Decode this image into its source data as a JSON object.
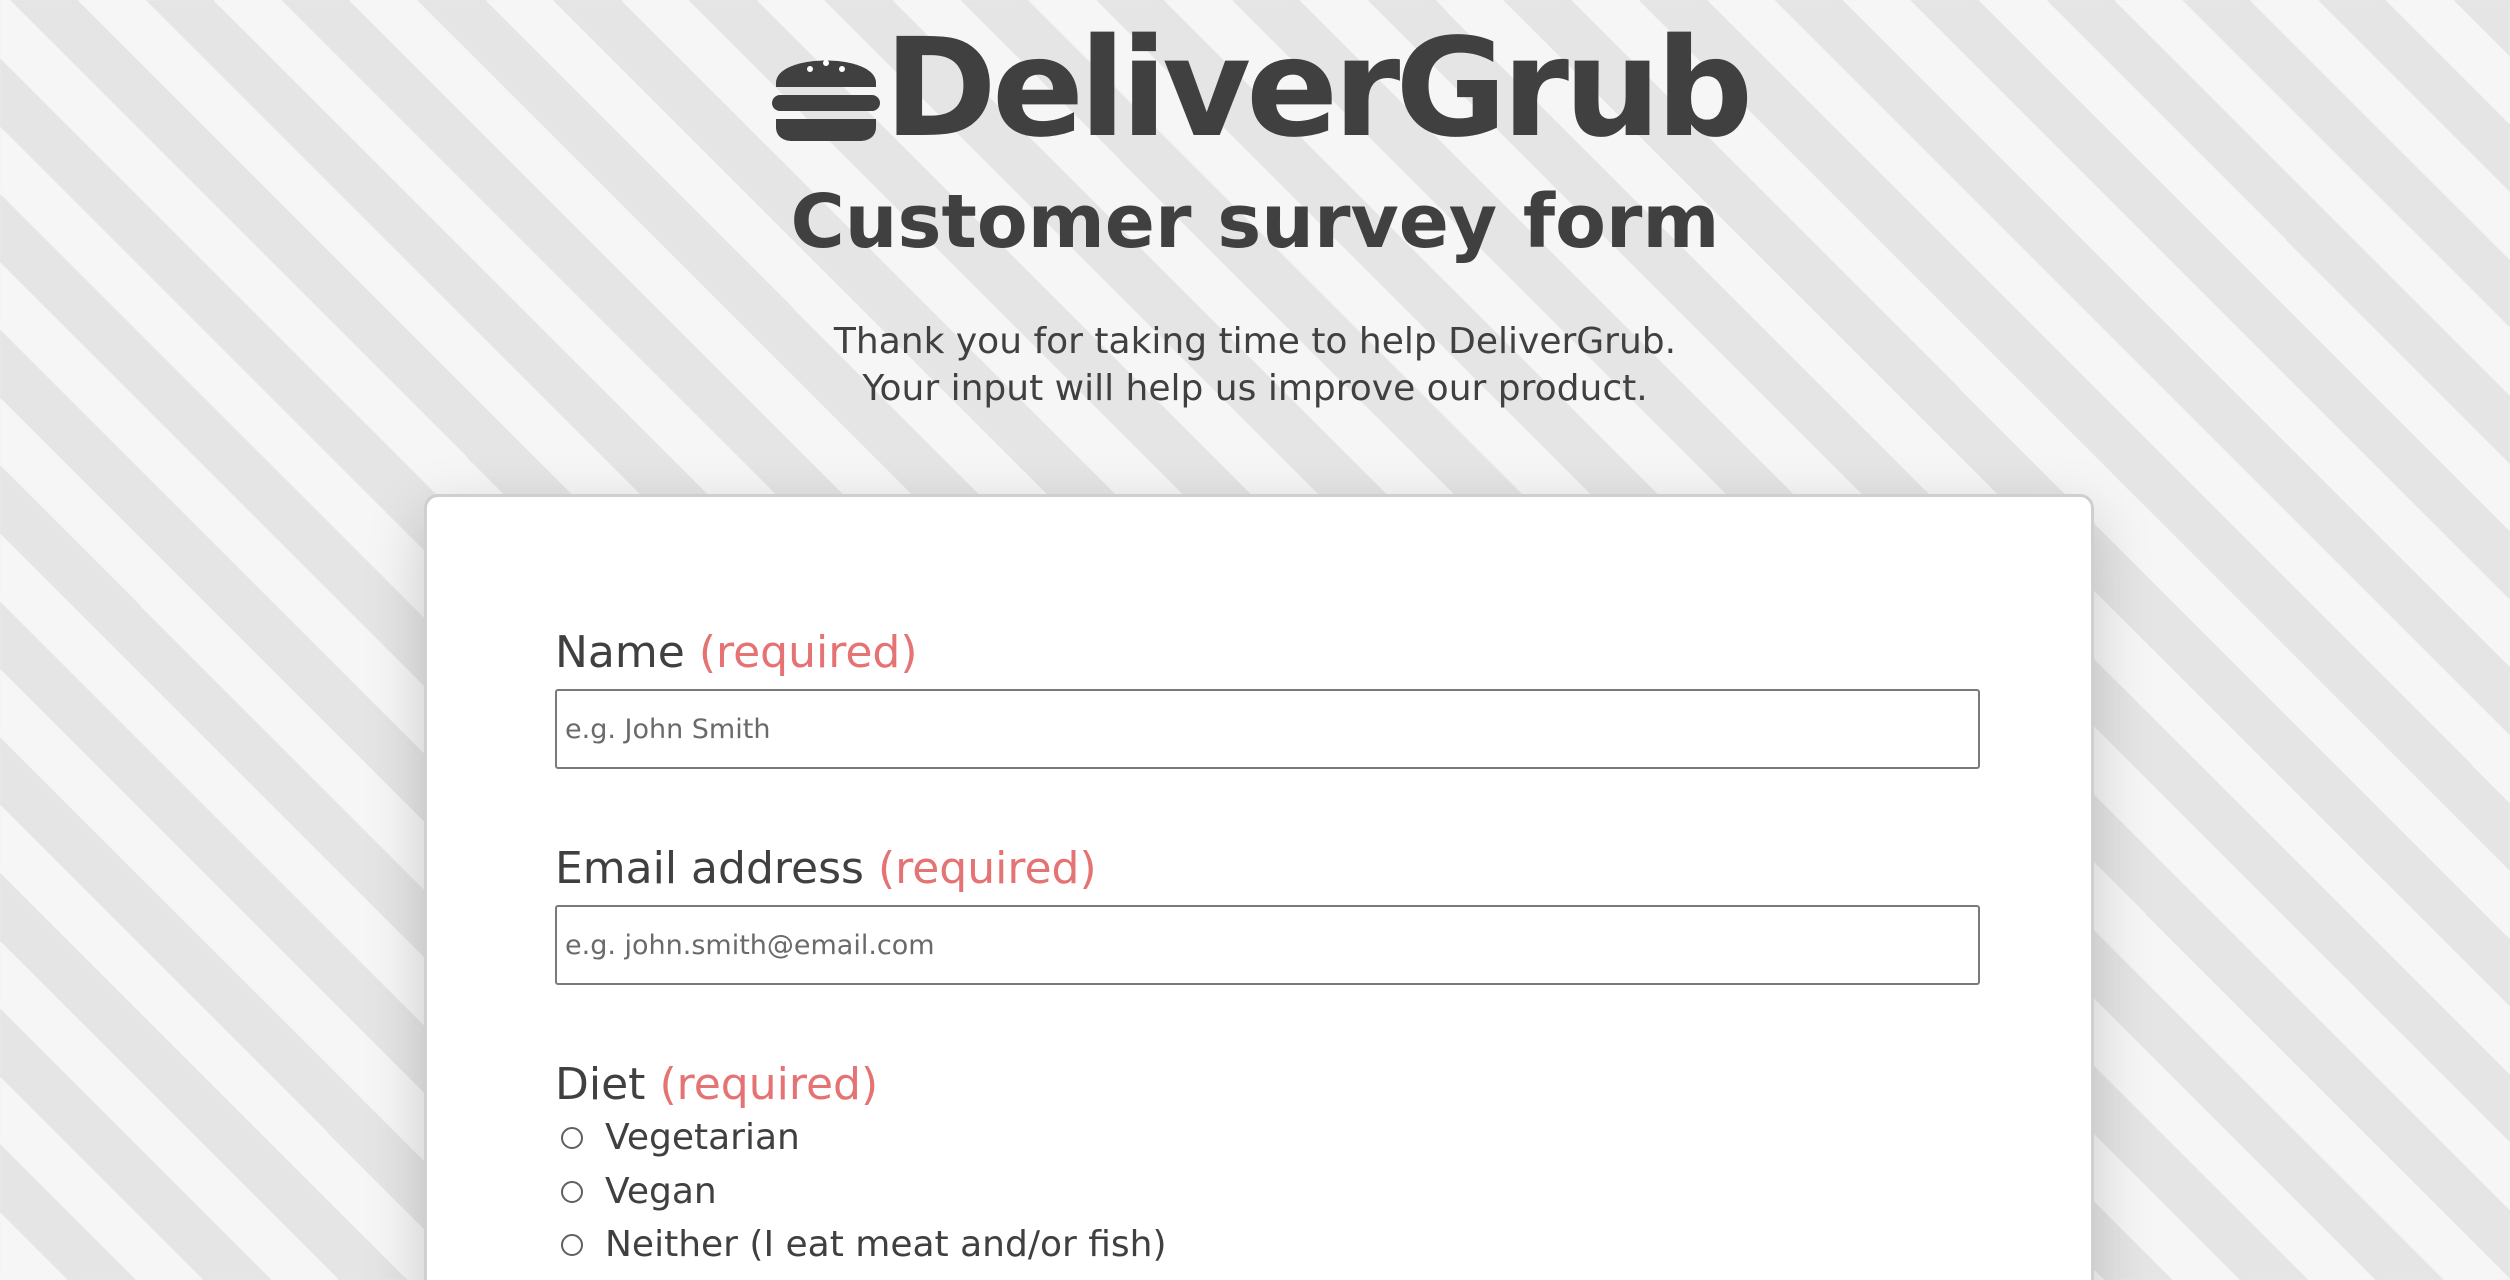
{
  "brand": {
    "icon": "burger-icon",
    "name": "DeliverGrub"
  },
  "page": {
    "title": "Customer survey form",
    "intro_line1": "Thank you for taking time to help DeliverGrub.",
    "intro_line2": "Your input will help us improve our product."
  },
  "form": {
    "name": {
      "label": "Name",
      "required": "(required)",
      "placeholder": "e.g. John Smith",
      "value": ""
    },
    "email": {
      "label": "Email address",
      "required": "(required)",
      "placeholder": "e.g. john.smith@email.com",
      "value": ""
    },
    "diet": {
      "label": "Diet",
      "required": "(required)",
      "options": [
        {
          "label": "Vegetarian",
          "selected": false
        },
        {
          "label": "Vegan",
          "selected": false
        },
        {
          "label": "Neither (I eat meat and/or fish)",
          "selected": false
        }
      ]
    }
  },
  "colors": {
    "text": "#404040",
    "required": "#e57373",
    "card_bg": "#ffffff",
    "stripe_light": "#f6f6f6",
    "stripe_dark": "#e5e5e5"
  }
}
